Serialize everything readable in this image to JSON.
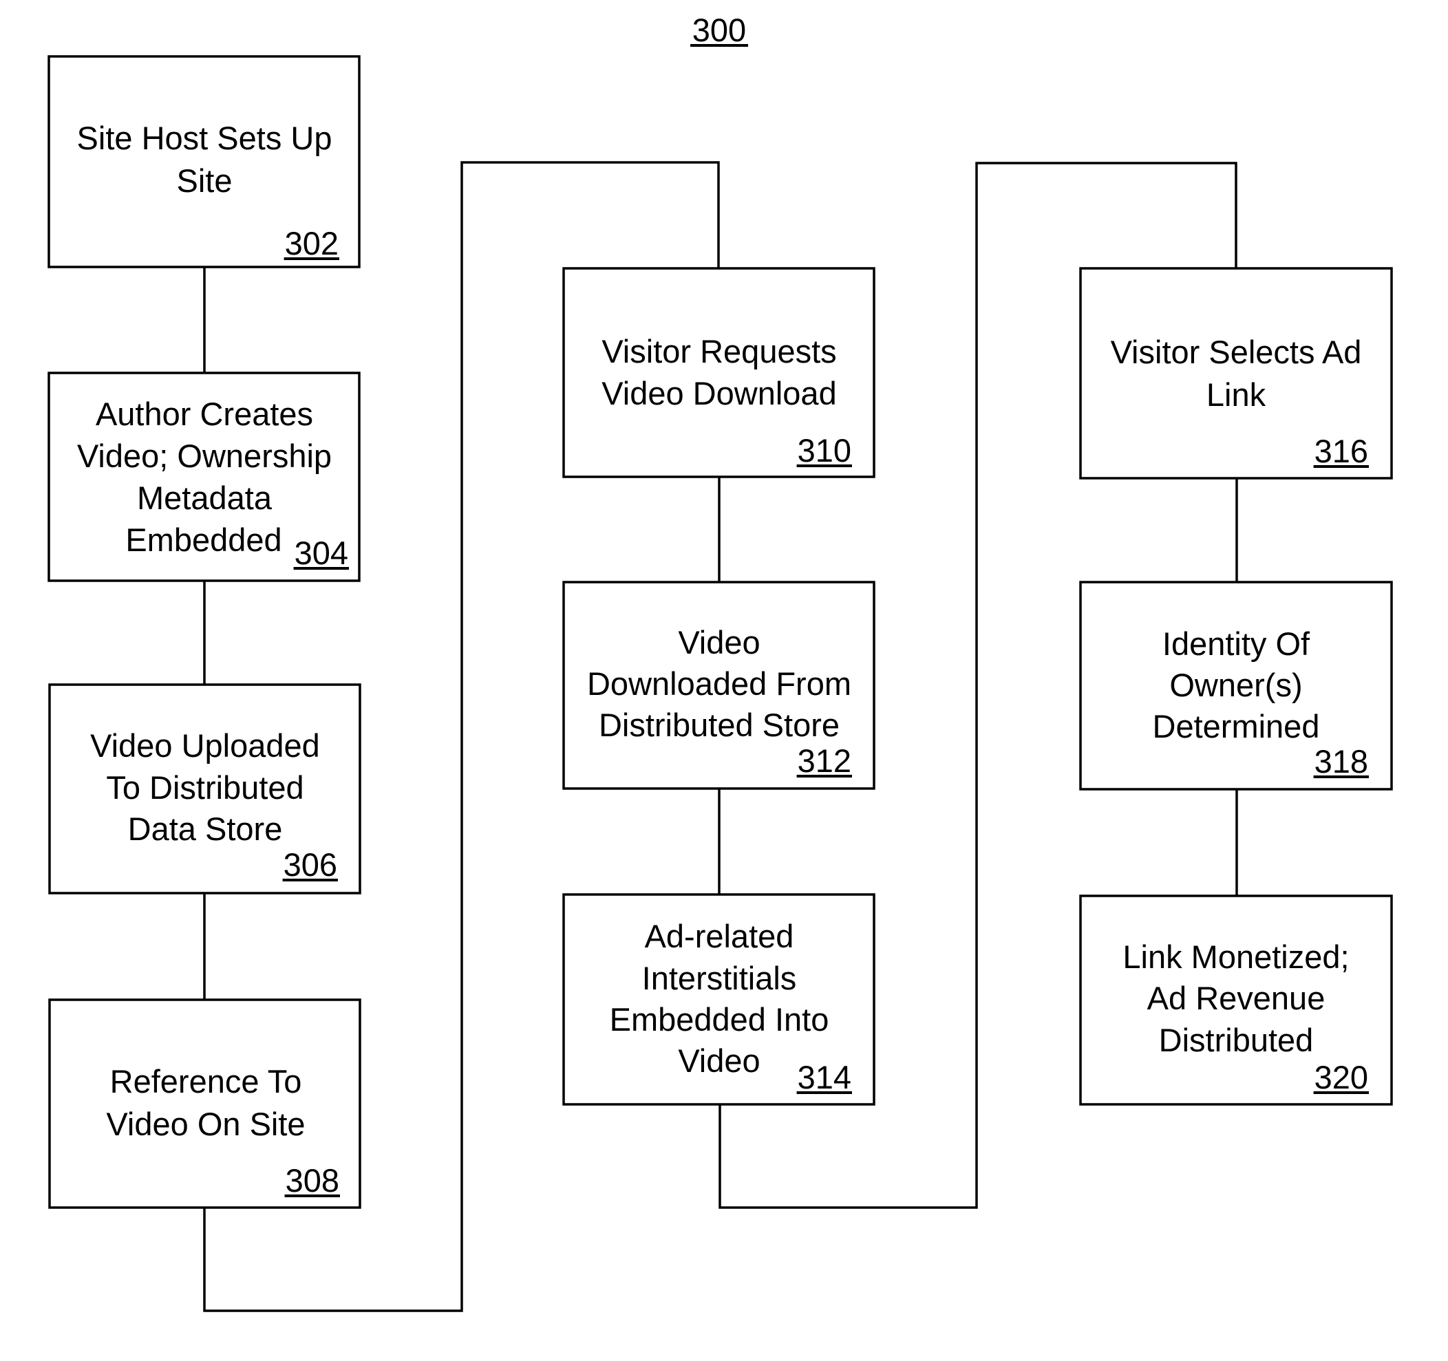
{
  "figure": {
    "number": "300",
    "colors": {
      "line": "#000000",
      "background": "#ffffff"
    }
  },
  "steps": [
    {
      "id": "302",
      "lines": [
        "Site Host Sets Up",
        "Site"
      ]
    },
    {
      "id": "304",
      "lines": [
        "Author Creates",
        "Video; Ownership",
        "Metadata",
        "Embedded"
      ]
    },
    {
      "id": "306",
      "lines": [
        "Video Uploaded",
        "To Distributed",
        "Data Store"
      ]
    },
    {
      "id": "308",
      "lines": [
        "Reference To",
        "Video On Site"
      ]
    },
    {
      "id": "310",
      "lines": [
        "Visitor Requests",
        "Video Download"
      ]
    },
    {
      "id": "312",
      "lines": [
        "Video",
        "Downloaded From",
        "Distributed Store"
      ]
    },
    {
      "id": "314",
      "lines": [
        "Ad-related",
        "Interstitials",
        "Embedded Into",
        "Video"
      ]
    },
    {
      "id": "316",
      "lines": [
        "Visitor Selects Ad",
        "Link"
      ]
    },
    {
      "id": "318",
      "lines": [
        "Identity Of",
        "Owner(s)",
        "Determined"
      ]
    },
    {
      "id": "320",
      "lines": [
        "Link Monetized;",
        "Ad Revenue",
        "Distributed"
      ]
    }
  ],
  "flow": [
    "302",
    "304",
    "306",
    "308",
    "310",
    "312",
    "314",
    "316",
    "318",
    "320"
  ]
}
